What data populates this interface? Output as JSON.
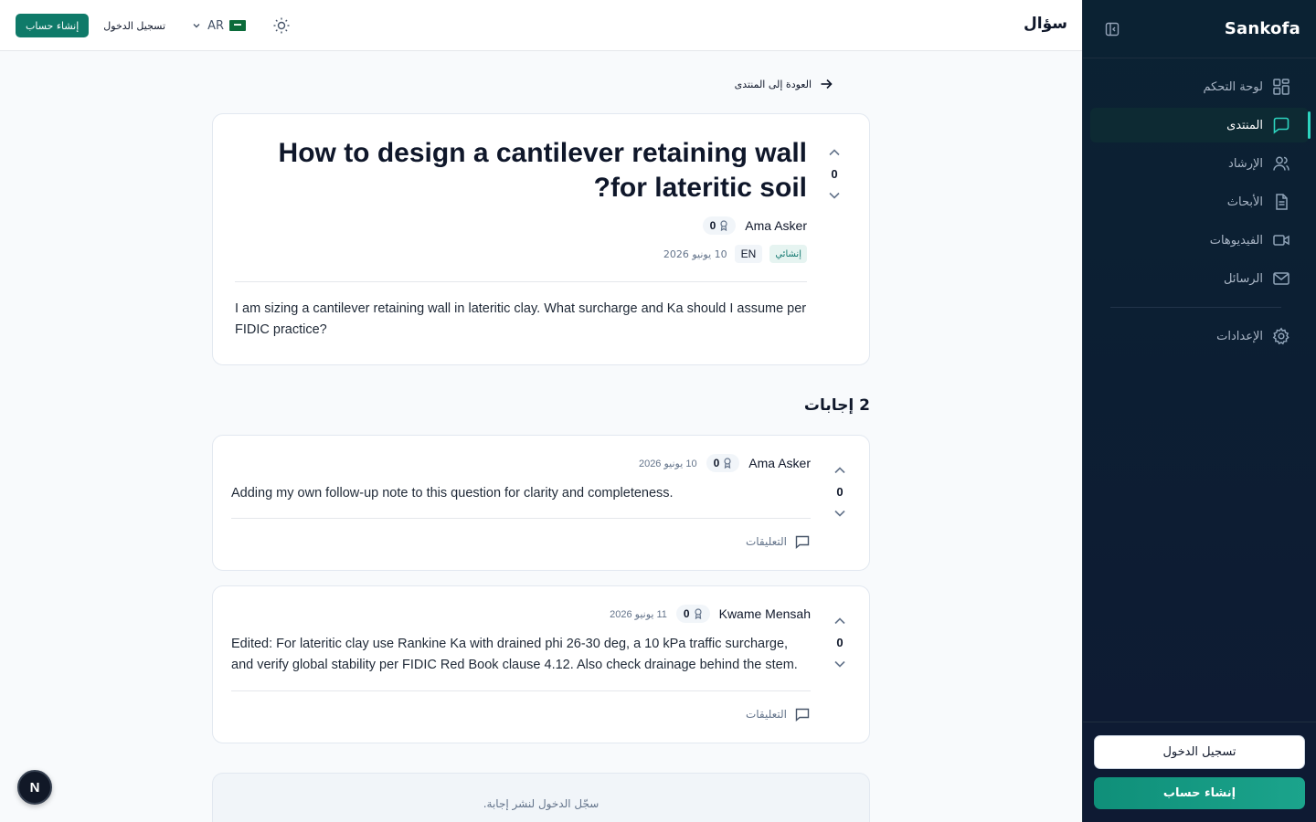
{
  "brand": "Sankofa",
  "sidebar": {
    "items": [
      {
        "label": "لوحة التحكم",
        "icon": "dashboard-icon"
      },
      {
        "label": "المنتدى",
        "icon": "forum-icon",
        "active": true
      },
      {
        "label": "الإرشاد",
        "icon": "users-icon"
      },
      {
        "label": "الأبحاث",
        "icon": "document-icon"
      },
      {
        "label": "الفيديوهات",
        "icon": "video-icon"
      },
      {
        "label": "الرسائل",
        "icon": "mail-icon"
      }
    ],
    "settings_label": "الإعدادات",
    "login_label": "تسجيل الدخول",
    "signup_label": "إنشاء حساب"
  },
  "header": {
    "title": "سؤال",
    "signup_label": "إنشاء حساب",
    "login_label": "تسجيل الدخول",
    "language": "AR"
  },
  "main": {
    "back_label": "العودة إلى المنتدى",
    "question": {
      "title": "How to design a cantilever retaining wall for lateritic soil?",
      "votes": "0",
      "author": "Ama Asker",
      "reputation": "0",
      "tag": "إنشائي",
      "language": "EN",
      "date": "10 يونيو 2026",
      "body": "I am sizing a cantilever retaining wall in lateritic clay. What surcharge and Ka should I assume per FIDIC practice?"
    },
    "answers_title": "2 إجابات",
    "answers": [
      {
        "author": "Ama Asker",
        "reputation": "0",
        "date": "10 يونيو 2026",
        "votes": "0",
        "body": "Adding my own follow-up note to this question for clarity and completeness.",
        "comments_label": "التعليقات"
      },
      {
        "author": "Kwame Mensah",
        "reputation": "0",
        "date": "11 يونيو 2026",
        "votes": "0",
        "body": "Edited: For lateritic clay use Rankine Ka with drained phi 26-30 deg, a 10 kPa traffic surcharge, and verify global stability per FIDIC Red Book clause 4.12. Also check drainage behind the stem.",
        "comments_label": "التعليقات"
      }
    ],
    "login_prompt": "سجّل الدخول لنشر إجابة."
  },
  "fab_label": "N",
  "colors": {
    "accent": "#0f7a69",
    "sidebar_bg": "#0b2233",
    "active_indicator": "#2dd4bf"
  }
}
